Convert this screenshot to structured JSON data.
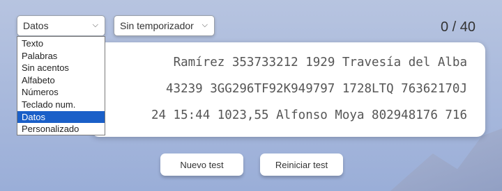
{
  "mode_select": {
    "value": "Datos",
    "options": [
      "Texto",
      "Palabras",
      "Sin acentos",
      "Alfabeto",
      "Números",
      "Teclado num.",
      "Datos",
      "Personalizado"
    ]
  },
  "timer_select": {
    "value": "Sin temporizador"
  },
  "counter": "0 / 40",
  "text_lines": [
    "Ramírez 353733212 1929 Travesía del Alba",
    "43239 3GG296TF92K949797 1728LTQ 76362170J",
    "24 15:44 1023,55 Alfonso Moya 802948176 716"
  ],
  "buttons": {
    "new_test": "Nuevo test",
    "restart_test": "Reiniciar test"
  }
}
